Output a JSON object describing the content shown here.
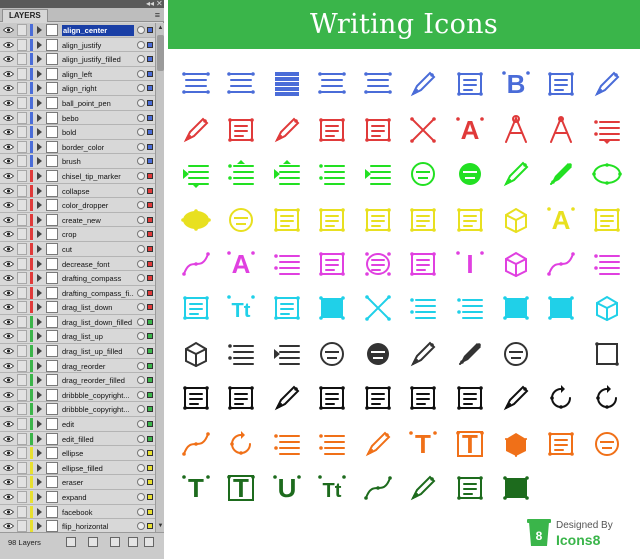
{
  "panel": {
    "tab_label": "LAYERS",
    "menu_glyph": "≡",
    "collapse_glyph": "◂◂",
    "close_glyph": "✕",
    "layer_count": "98 Layers",
    "layers": [
      {
        "name": "align_center",
        "color": "#4a6cd8",
        "selected": true
      },
      {
        "name": "align_justify",
        "color": "#4a6cd8"
      },
      {
        "name": "align_justify_filled",
        "color": "#4a6cd8"
      },
      {
        "name": "align_left",
        "color": "#4a6cd8"
      },
      {
        "name": "align_right",
        "color": "#4a6cd8"
      },
      {
        "name": "ball_point_pen",
        "color": "#4a6cd8"
      },
      {
        "name": "bebo",
        "color": "#4a6cd8"
      },
      {
        "name": "bold",
        "color": "#4a6cd8"
      },
      {
        "name": "border_color",
        "color": "#4a6cd8"
      },
      {
        "name": "brush",
        "color": "#4a6cd8"
      },
      {
        "name": "chisel_tip_marker",
        "color": "#e03a3a"
      },
      {
        "name": "collapse",
        "color": "#e03a3a"
      },
      {
        "name": "color_dropper",
        "color": "#e03a3a"
      },
      {
        "name": "create_new",
        "color": "#e03a3a"
      },
      {
        "name": "crop",
        "color": "#e03a3a"
      },
      {
        "name": "cut",
        "color": "#e03a3a"
      },
      {
        "name": "decrease_font",
        "color": "#e03a3a"
      },
      {
        "name": "drafting_compass",
        "color": "#e03a3a"
      },
      {
        "name": "drafting_compass_fi...",
        "color": "#e03a3a"
      },
      {
        "name": "drag_list_down",
        "color": "#e03a3a"
      },
      {
        "name": "drag_list_down_filled",
        "color": "#3bb54a"
      },
      {
        "name": "drag_list_up",
        "color": "#3bb54a"
      },
      {
        "name": "drag_list_up_filled",
        "color": "#3bb54a"
      },
      {
        "name": "drag_reorder",
        "color": "#3bb54a"
      },
      {
        "name": "drag_reorder_filled",
        "color": "#3bb54a"
      },
      {
        "name": "dribbble_copyright...",
        "color": "#3bb54a"
      },
      {
        "name": "dribbble_copyright...",
        "color": "#3bb54a"
      },
      {
        "name": "edit",
        "color": "#3bb54a"
      },
      {
        "name": "edit_filled",
        "color": "#3bb54a"
      },
      {
        "name": "ellipse",
        "color": "#e8e030"
      },
      {
        "name": "ellipse_filled",
        "color": "#e8e030"
      },
      {
        "name": "eraser",
        "color": "#e8e030"
      },
      {
        "name": "expand",
        "color": "#e8e030"
      },
      {
        "name": "facebook",
        "color": "#e8e030"
      },
      {
        "name": "flip_horizontal",
        "color": "#e8e030"
      }
    ]
  },
  "poster": {
    "title": "Writing Icons",
    "credit_by": "Designed By",
    "credit_brand": "Icons8",
    "credit_badge": "8"
  },
  "colors": {
    "banner": "#3ab54a",
    "row1": "#4a6cd8",
    "row2": "#e03a3a",
    "row3": "#22e022",
    "row4": "#e8e020",
    "row5": "#e040e0",
    "row6": "#20d0e8",
    "row7": "#333333",
    "row8": "#111111",
    "row9": "#f07018",
    "row10": "#1d6b1d"
  },
  "icon_rows": [
    {
      "color_key": "row1",
      "icons": [
        "align-center-icon",
        "align-justify-icon",
        "align-justify-filled-icon",
        "align-left-icon",
        "align-right-icon",
        "ball-point-pen-icon",
        "bebo-icon",
        "bold-icon",
        "border-color-icon",
        "brush-icon"
      ]
    },
    {
      "color_key": "row2",
      "icons": [
        "chisel-tip-marker-icon",
        "collapse-icon",
        "color-dropper-icon",
        "create-new-icon",
        "crop-icon",
        "cut-icon",
        "decrease-font-icon",
        "drafting-compass-icon",
        "drafting-compass-filled-icon",
        "drag-list-down-icon"
      ]
    },
    {
      "color_key": "row3",
      "icons": [
        "drag-list-down-filled-icon",
        "drag-list-up-icon",
        "drag-list-up-filled-icon",
        "drag-reorder-icon",
        "drag-reorder-filled-icon",
        "dribbble-copyright-icon",
        "dribbble-copyright-filled-icon",
        "edit-icon",
        "edit-filled-icon",
        "ellipse-icon"
      ]
    },
    {
      "color_key": "row4",
      "icons": [
        "ellipse-filled-icon",
        "eraser-icon",
        "expand-icon",
        "facebook-icon",
        "flip-horizontal-icon",
        "flip-vertical-icon",
        "google-plus-icon",
        "hexahedron-icon",
        "increase-font-icon",
        "instagram-icon"
      ]
    },
    {
      "color_key": "row5",
      "icons": [
        "line-icon",
        "font-plus-icon",
        "list-icon",
        "grid-icon",
        "lens-icon",
        "linkedin-icon",
        "italic-icon",
        "cube-icon",
        "line-diagonal-icon",
        "menu-icon"
      ]
    },
    {
      "color_key": "row6",
      "icons": [
        "linkedin-box-icon",
        "text-size-icon",
        "picture-icon",
        "picture-filled-icon",
        "move-icon",
        "list-numbered-icon",
        "list-bullet-icon",
        "pattern-icon",
        "pattern-filled-icon",
        "box-3d-icon"
      ]
    },
    {
      "color_key": "row7",
      "icons": [
        "polygon-icon",
        "list-arrow-icon",
        "list-arrow-filled-icon",
        "helmet-icon",
        "helmet-filled-icon",
        "quill-icon",
        "quill-filled-icon",
        "palette-icon",
        "",
        "page-icon"
      ]
    },
    {
      "color_key": "row8",
      "icons": [
        "news-icon",
        "news-plus-icon",
        "pen-nib-icon",
        "select-points-icon",
        "move-points-icon",
        "rectangle-icon",
        "rectangle-points-icon",
        "paint-roller-icon",
        "rotate-left-icon",
        "rotate-right-icon"
      ]
    },
    {
      "color_key": "row9",
      "icons": [
        "chain-icon",
        "circle-dots-icon",
        "page-lines-icon",
        "page-list-icon",
        "pencil-link-icon",
        "text-t-icon",
        "text-t-box-icon",
        "cube-filled-icon",
        "tumblr-icon",
        "twitter-icon"
      ]
    },
    {
      "color_key": "row10",
      "icons": [
        "text-tool-icon",
        "text-tool-filled-icon",
        "underline-icon",
        "text-tt-icon",
        "vector-path-icon",
        "vector-edit-icon",
        "vimeo-icon",
        "vimeo-filled-icon",
        "",
        ""
      ]
    }
  ]
}
